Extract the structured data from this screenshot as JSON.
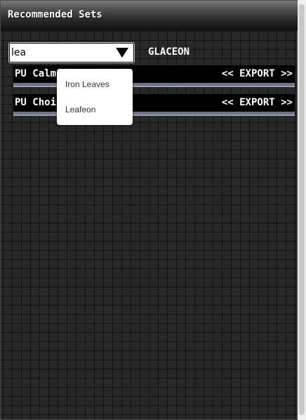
{
  "panel": {
    "title": "Recommended Sets"
  },
  "search": {
    "value": "lea",
    "pokemon_name": "GLACEON"
  },
  "sets": [
    {
      "name_visible": "PU Calm ",
      "export_label": "<< EXPORT >>"
    },
    {
      "name_visible": "PU Choic",
      "export_label": "<< EXPORT >>"
    }
  ],
  "suggestions": [
    {
      "label": "Iron Leaves"
    },
    {
      "label": "Leafeon"
    }
  ]
}
